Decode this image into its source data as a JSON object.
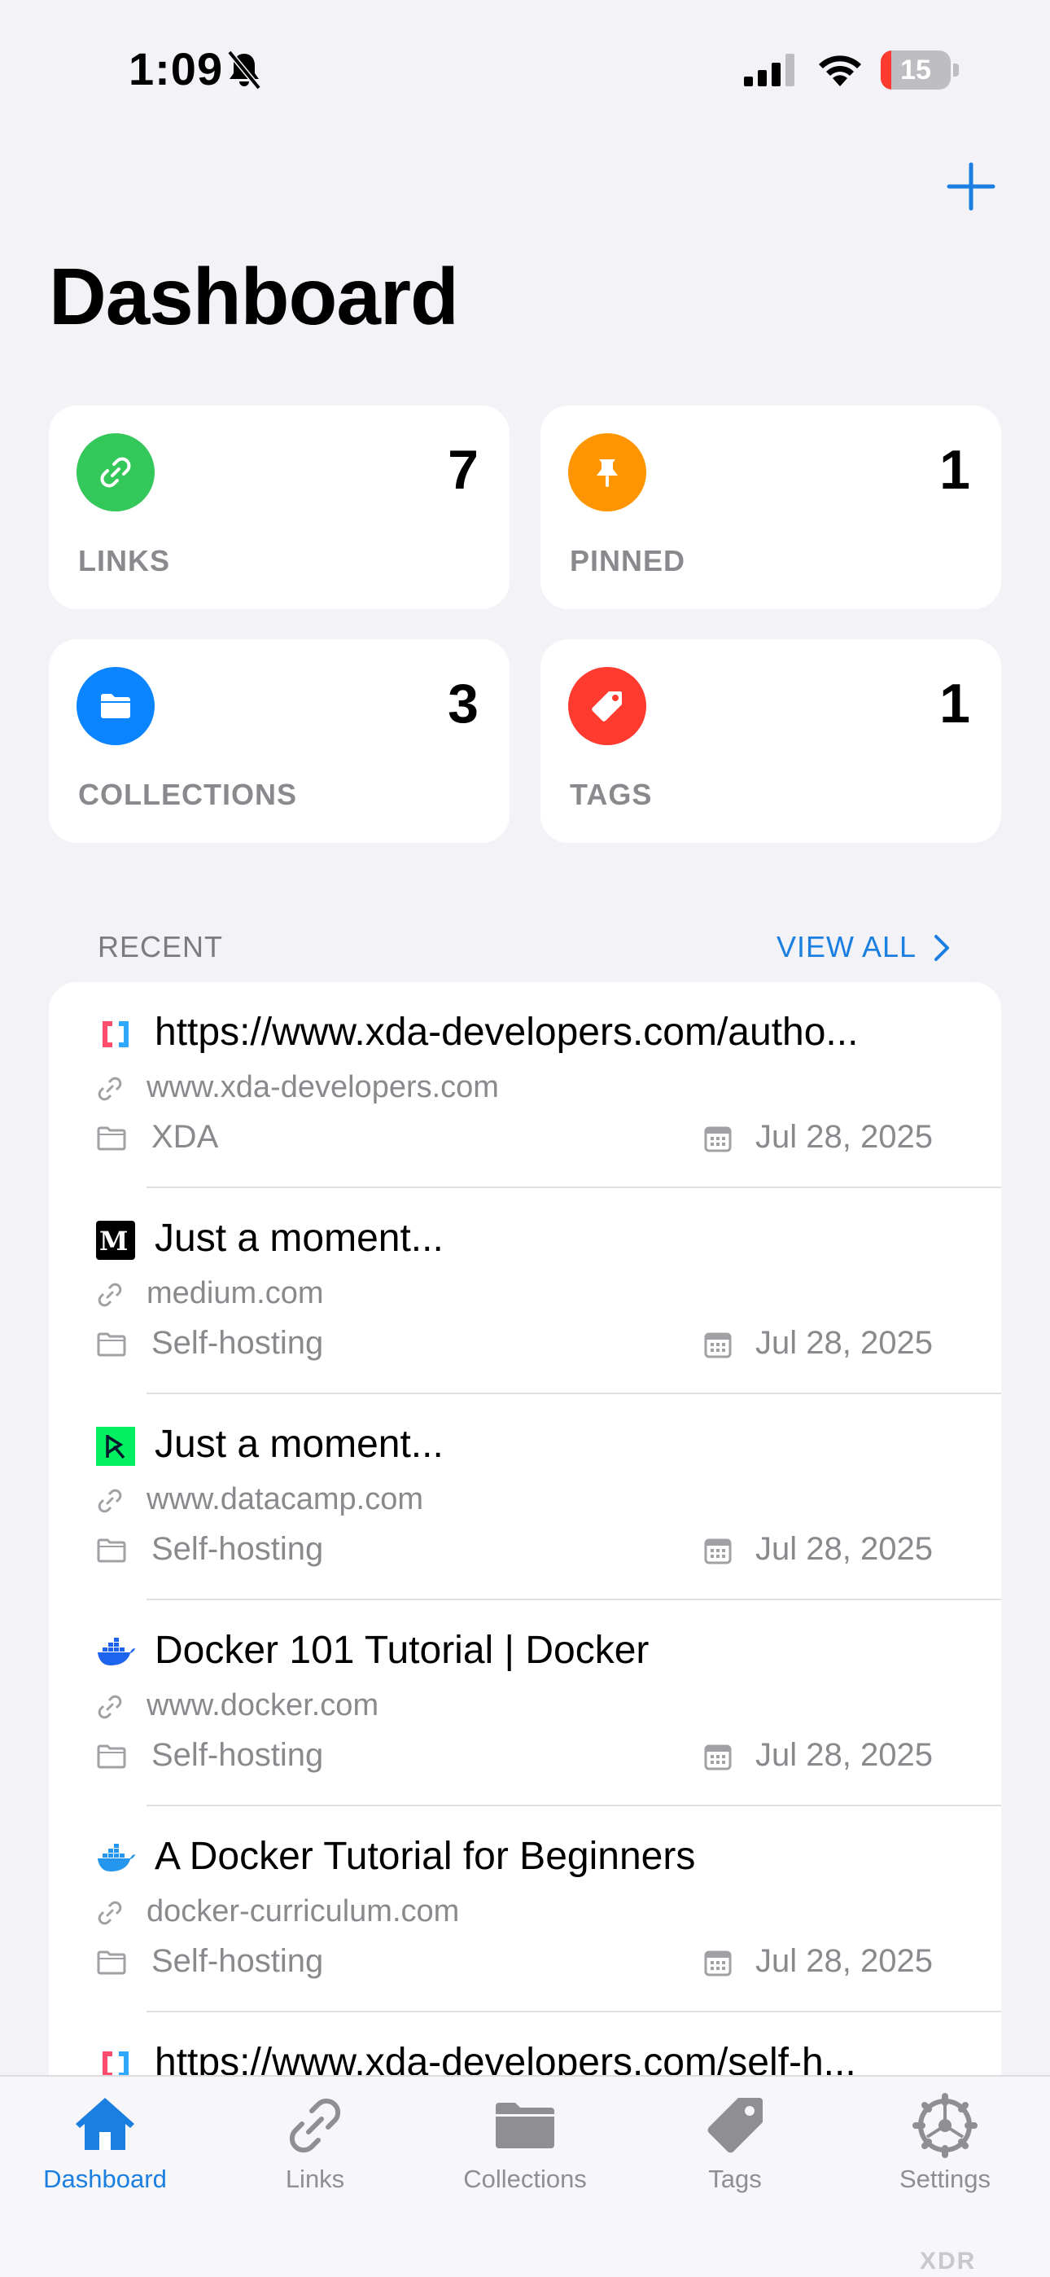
{
  "status_bar": {
    "time": "1:09",
    "battery": "15",
    "battery_level": 0.15
  },
  "page_title": "Dashboard",
  "stats": [
    {
      "label": "LINKS",
      "count": "7",
      "color": "#34c759",
      "icon": "link-icon"
    },
    {
      "label": "PINNED",
      "count": "1",
      "color": "#ff9500",
      "icon": "pin-icon"
    },
    {
      "label": "COLLECTIONS",
      "count": "3",
      "color": "#0a84ff",
      "icon": "folder-icon"
    },
    {
      "label": "TAGS",
      "count": "1",
      "color": "#ff3b30",
      "icon": "tag-icon"
    }
  ],
  "recent": {
    "header": "RECENT",
    "view_all": "VIEW ALL",
    "items": [
      {
        "title": "https://www.xda-developers.com/autho...",
        "domain": "www.xda-developers.com",
        "collection": "XDA",
        "date": "Jul 28, 2025",
        "favicon": "xda-icon"
      },
      {
        "title": "Just a moment...",
        "domain": "medium.com",
        "collection": "Self-hosting",
        "date": "Jul 28, 2025",
        "favicon": "medium-icon"
      },
      {
        "title": "Just a moment...",
        "domain": "www.datacamp.com",
        "collection": "Self-hosting",
        "date": "Jul 28, 2025",
        "favicon": "datacamp-icon"
      },
      {
        "title": "Docker 101 Tutorial | Docker",
        "domain": "www.docker.com",
        "collection": "Self-hosting",
        "date": "Jul 28, 2025",
        "favicon": "docker-icon"
      },
      {
        "title": "A Docker Tutorial for Beginners",
        "domain": "docker-curriculum.com",
        "collection": "Self-hosting",
        "date": "Jul 28, 2025",
        "favicon": "docker-icon"
      },
      {
        "title": "https://www.xda-developers.com/self-h...",
        "domain": "",
        "collection": "",
        "date": "",
        "favicon": "xda-icon"
      }
    ]
  },
  "tabs": [
    {
      "label": "Dashboard",
      "icon": "house-icon",
      "active": true
    },
    {
      "label": "Links",
      "icon": "link-icon",
      "active": false
    },
    {
      "label": "Collections",
      "icon": "folder-icon",
      "active": false
    },
    {
      "label": "Tags",
      "icon": "tag-icon",
      "active": false
    },
    {
      "label": "Settings",
      "icon": "gear-icon",
      "active": false
    }
  ],
  "watermark": "XDR",
  "accent_color": "#1a7fe0"
}
